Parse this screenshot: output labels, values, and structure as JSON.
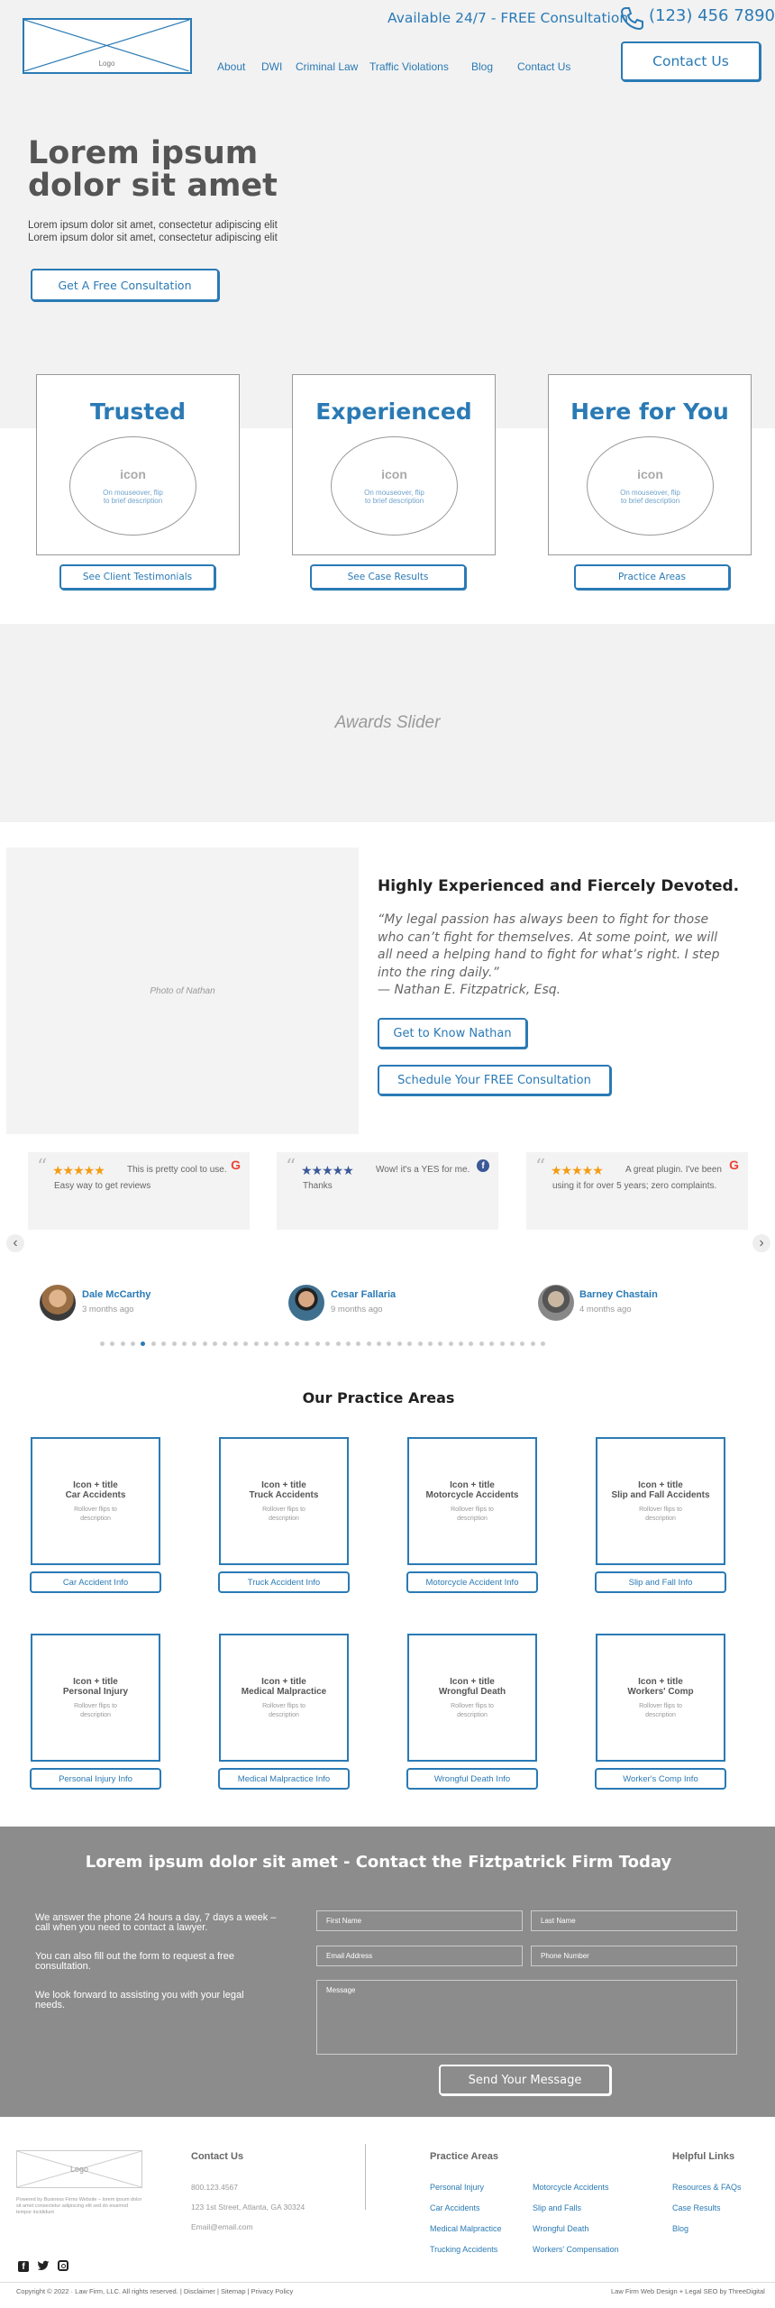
{
  "header": {
    "logo": "Logo",
    "availability": "Available 24/7 - FREE Consultation",
    "phone": "(123) 456 7890",
    "contact_button": "Contact Us",
    "nav": [
      "About",
      "DWI",
      "Criminal Law",
      "Traffic Violations",
      "Blog",
      "Contact Us"
    ]
  },
  "hero": {
    "title_line1": "Lorem ipsum",
    "title_line2": "dolor sit amet",
    "sub_line1": "Lorem ipsum dolor sit amet, consectetur adipiscing elit",
    "sub_line2": "Lorem ipsum dolor sit amet, consectetur adipiscing elit",
    "cta": "Get A Free Consultation"
  },
  "features": [
    {
      "title": "Trusted",
      "icon": "icon",
      "hover1": "On mouseover, flip",
      "hover2": "to brief description",
      "button": "See Client Testimonials"
    },
    {
      "title": "Experienced",
      "icon": "icon",
      "hover1": "On mouseover, flip",
      "hover2": "to brief description",
      "button": "See Case Results"
    },
    {
      "title": "Here for You",
      "icon": "icon",
      "hover1": "On mouseover, flip",
      "hover2": "to brief description",
      "button": "Practice Areas"
    }
  ],
  "awards": {
    "label": "Awards Slider"
  },
  "about": {
    "photo_label": "Photo of Nathan",
    "heading": "Highly Experienced and Fiercely Devoted.",
    "quote1": "“My legal passion has always been to fight for those",
    "quote2": "who can’t fight for themselves. At some point, we will",
    "quote3": "all need a helping hand to fight for what’s right. I step",
    "quote4": "into the ring daily.”",
    "quote_author": "— Nathan E. Fitzpatrick, Esq.",
    "btn_know": "Get to Know Nathan",
    "btn_schedule": "Schedule Your FREE Consultation"
  },
  "reviews": [
    {
      "stars": "★★★★★",
      "line1": "This is pretty cool to use.",
      "line2": "Easy way to get reviews",
      "name": "Dale McCarthy",
      "time": "3 months ago",
      "source": "G",
      "star_color": "#f39c12"
    },
    {
      "stars": "★★★★★",
      "line1": "Wow! it's a YES for me.",
      "line2": "Thanks",
      "name": "Cesar Fallaria",
      "time": "9 months ago",
      "source": "f",
      "star_color": "#3b5998"
    },
    {
      "stars": "★★★★★",
      "line1": "A great plugin. I've been",
      "line2": "using it for over 5 years; zero complaints.",
      "name": "Barney Chastain",
      "time": "4 months ago",
      "source": "G",
      "star_color": "#f39c12"
    }
  ],
  "slider": {
    "prev": "‹",
    "next": "›",
    "dots": 44,
    "active_dot": 4
  },
  "practice": {
    "heading": "Our Practice Areas",
    "items": [
      {
        "top": "Icon + title",
        "title": "Car Accidents",
        "desc1": "Rollover flips to",
        "desc2": "description",
        "button": "Car Accident Info"
      },
      {
        "top": "Icon + title",
        "title": "Truck Accidents",
        "desc1": "Rollover flips to",
        "desc2": "description",
        "button": "Truck Accident Info"
      },
      {
        "top": "Icon + title",
        "title": "Motorcycle Accidents",
        "desc1": "Rollover flips to",
        "desc2": "description",
        "button": "Motorcycle Accident Info"
      },
      {
        "top": "Icon + title",
        "title": "Slip and Fall Accidents",
        "desc1": "Rollover flips to",
        "desc2": "description",
        "button": "Slip and Fall Info"
      },
      {
        "top": "Icon + title",
        "title": "Personal Injury",
        "desc1": "Rollover flips to",
        "desc2": "description",
        "button": "Personal Injury Info"
      },
      {
        "top": "Icon + title",
        "title": "Medical Malpractice",
        "desc1": "Rollover flips to",
        "desc2": "description",
        "button": "Medical Malpractice Info"
      },
      {
        "top": "Icon + title",
        "title": "Wrongful Death",
        "desc1": "Rollover flips to",
        "desc2": "description",
        "button": "Wrongful Death Info"
      },
      {
        "top": "Icon + title",
        "title": "Workers' Comp",
        "desc1": "Rollover flips to",
        "desc2": "description",
        "button": "Worker's Comp Info"
      }
    ]
  },
  "contact": {
    "heading": "Lorem ipsum dolor sit amet - Contact the Fiztpatrick Firm Today",
    "p1a": "We answer the phone 24 hours a day, 7 days a week –",
    "p1b": "call when you need to contact a lawyer.",
    "p2a": "You can also fill out the form to request a free",
    "p2b": "consultation.",
    "p3a": "We look forward to assisting you with your legal",
    "p3b": "needs.",
    "first_name": "First Name",
    "last_name": "Last Name",
    "email": "Email Address",
    "phone": "Phone Number",
    "message": "Message",
    "send": "Send Your Message"
  },
  "footer": {
    "logo": "Logo",
    "logo_note": "Powered by Business Firms Website – lorem ipsum dolor sit amet consectetur adipiscing elit sed do eiusmod tempor incididunt",
    "contact_heading": "Contact Us",
    "phone": "800.123.4567",
    "address": "123 1st Street, Atlanta, GA 30324",
    "email": "Email@email.com",
    "practice_heading": "Practice Areas",
    "practice_col1": [
      "Personal Injury",
      "Car Accidents",
      "Medical Malpractice",
      "Trucking Accidents"
    ],
    "practice_col2": [
      "Motorcycle Accidents",
      "Slip and Falls",
      "Wrongful Death",
      "Workers' Compensation"
    ],
    "links_heading": "Helpful Links",
    "links": [
      "Resources & FAQs",
      "Case Results",
      "Blog"
    ],
    "copyright": "Copyright © 2022 · Law Firm, LLC. All rights reserved. | Disclaimer | Sitemap | Privacy Policy",
    "credit": "Law Firm Web Design + Legal SEO by ThreeDigital"
  }
}
